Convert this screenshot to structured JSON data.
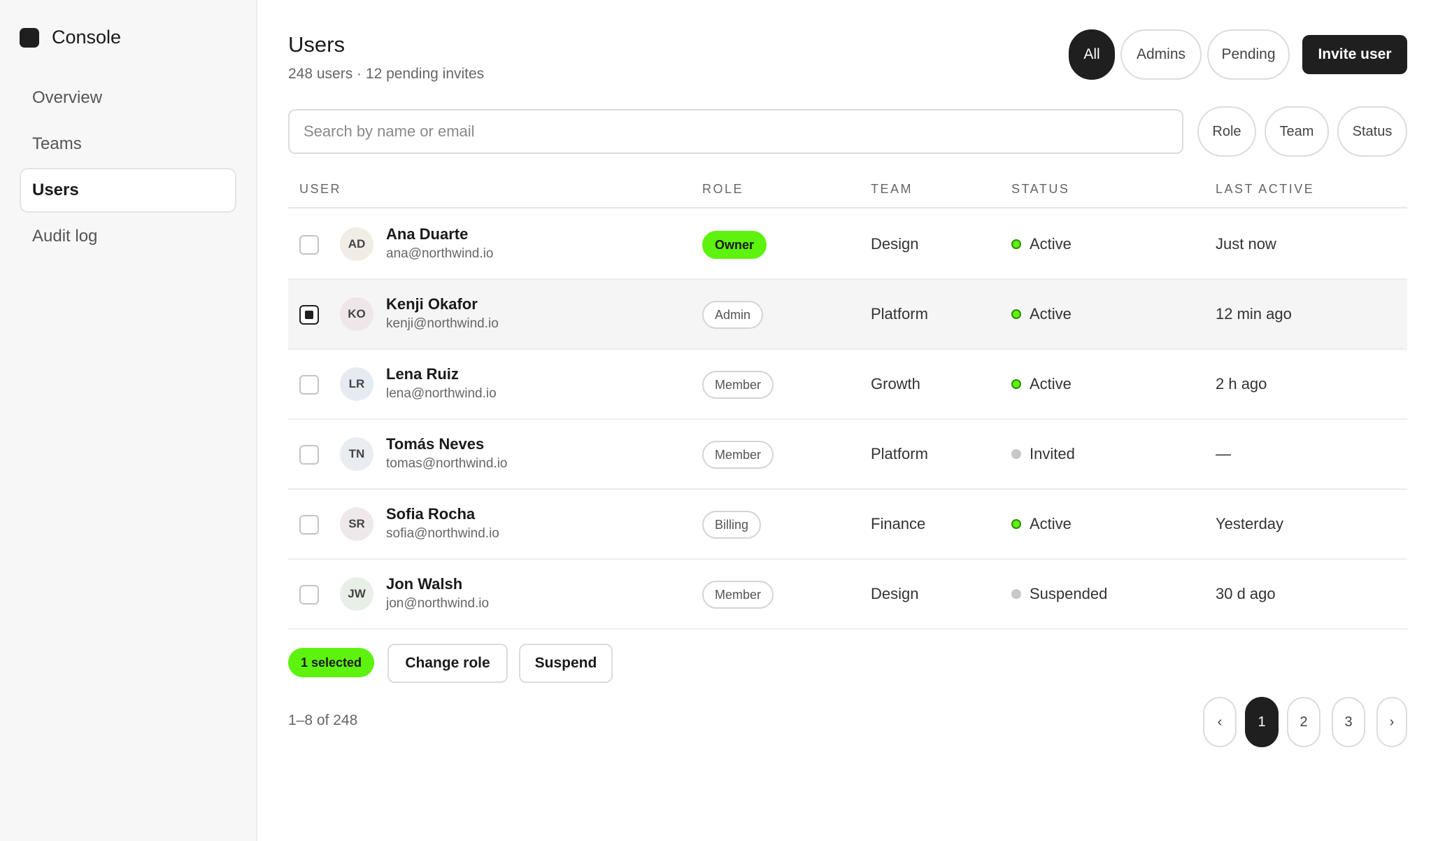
{
  "brand": {
    "name": "Console"
  },
  "sidebar": {
    "items": [
      {
        "label": "Overview"
      },
      {
        "label": "Teams"
      },
      {
        "label": "Users",
        "active": true
      },
      {
        "label": "Audit log"
      }
    ]
  },
  "header": {
    "title": "Users",
    "subtitle": "248 users · 12 pending invites",
    "segments": [
      "All",
      "Admins",
      "Pending"
    ],
    "active_segment": "All",
    "invite_label": "Invite user"
  },
  "search": {
    "placeholder": "Search by name or email",
    "value": ""
  },
  "filters": [
    "Role",
    "Team",
    "Status"
  ],
  "table": {
    "columns": [
      "USER",
      "ROLE",
      "TEAM",
      "STATUS",
      "LAST ACTIVE"
    ],
    "rows": [
      {
        "initials": "AD",
        "name": "Ana Duarte",
        "email": "ana@northwind.io",
        "role": "Owner",
        "team": "Design",
        "status": "Active",
        "last_active": "Just now",
        "selected": false,
        "avatar_color": "#f1ece4"
      },
      {
        "initials": "KO",
        "name": "Kenji Okafor",
        "email": "kenji@northwind.io",
        "role": "Admin",
        "team": "Platform",
        "status": "Active",
        "last_active": "12 min ago",
        "selected": true,
        "avatar_color": "#efe6ea"
      },
      {
        "initials": "LR",
        "name": "Lena Ruiz",
        "email": "lena@northwind.io",
        "role": "Member",
        "team": "Growth",
        "status": "Active",
        "last_active": "2 h ago",
        "selected": false,
        "avatar_color": "#e6ebf2"
      },
      {
        "initials": "TN",
        "name": "Tomás Neves",
        "email": "tomas@northwind.io",
        "role": "Member",
        "team": "Platform",
        "status": "Invited",
        "last_active": "—",
        "selected": false,
        "avatar_color": "#e9ecf1"
      },
      {
        "initials": "SR",
        "name": "Sofia Rocha",
        "email": "sofia@northwind.io",
        "role": "Billing",
        "team": "Finance",
        "status": "Active",
        "last_active": "Yesterday",
        "selected": false,
        "avatar_color": "#efe8ea"
      },
      {
        "initials": "JW",
        "name": "Jon Walsh",
        "email": "jon@northwind.io",
        "role": "Member",
        "team": "Design",
        "status": "Suspended",
        "last_active": "30 d ago",
        "selected": false,
        "avatar_color": "#e7efe6"
      }
    ]
  },
  "bulk": {
    "selected_label": "1 selected",
    "change_role_label": "Change role",
    "suspend_label": "Suspend"
  },
  "pagination": {
    "range": "1–8 of 248",
    "prev": "‹",
    "pages": [
      "1",
      "2",
      "3"
    ],
    "current": "1",
    "next": "›"
  },
  "colors": {
    "accent": "#5ef20f",
    "dark": "#1f1f1f"
  }
}
